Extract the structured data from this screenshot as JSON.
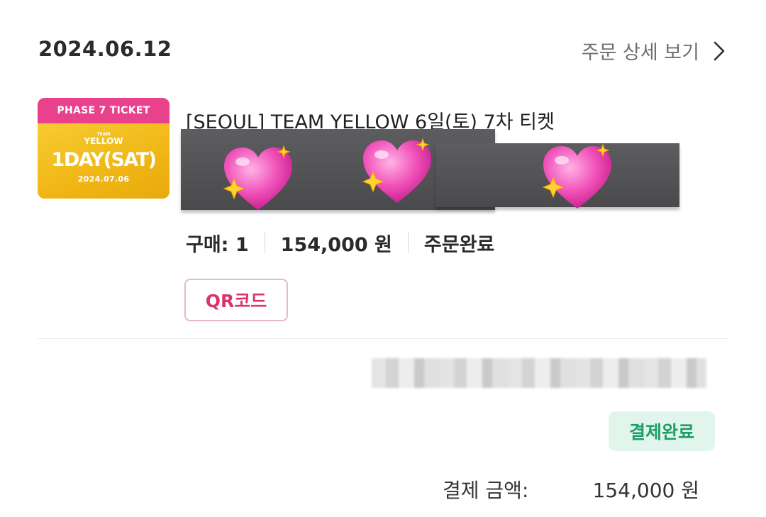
{
  "order": {
    "date": "2024.06.12",
    "detail_link_label": "주문 상세 보기"
  },
  "product": {
    "thumbnail": {
      "banner": "PHASE 7 TICKET",
      "team_small": "TEAM",
      "team_name": "YELLOW",
      "day": "1DAY(SAT)",
      "date": "2024.07.06"
    },
    "title": "[SEOUL] TEAM YELLOW 6일(토) 7차 티켓",
    "quantity": "구매: 1",
    "price": "154,000 원",
    "status": "주문완료",
    "qr_button_label": "QR코드"
  },
  "payment": {
    "status_badge": "결제완료",
    "total_label": "결제 금액:",
    "total_value": "154,000 원"
  },
  "colors": {
    "accent_pink": "#d9346f",
    "success_green": "#1f9e68",
    "thumbnail_yellow": "#f4c21f",
    "thumbnail_pink": "#e9418c"
  },
  "icons": {
    "detail_link": "chevron-right-icon",
    "redaction_sticker": "sparkling-heart-icon"
  }
}
